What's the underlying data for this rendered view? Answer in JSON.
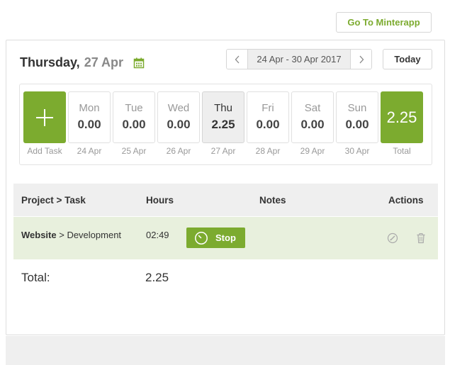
{
  "header": {
    "goto_label": "Go To Minterapp"
  },
  "toolbar": {
    "weekday": "Thursday,",
    "daymonth": "27 Apr",
    "calendar_icon": "calendar-icon",
    "range_label": "24 Apr - 30 Apr 2017",
    "prev_icon": "chevron-left-icon",
    "next_icon": "chevron-right-icon",
    "today_label": "Today"
  },
  "week": {
    "add_label": "Add Task",
    "add_icon": "plus-icon",
    "days": [
      {
        "name": "Mon",
        "value": "0.00",
        "date": "24 Apr",
        "active": false
      },
      {
        "name": "Tue",
        "value": "0.00",
        "date": "25 Apr",
        "active": false
      },
      {
        "name": "Wed",
        "value": "0.00",
        "date": "26 Apr",
        "active": false
      },
      {
        "name": "Thu",
        "value": "2.25",
        "date": "27 Apr",
        "active": true
      },
      {
        "name": "Fri",
        "value": "0.00",
        "date": "28 Apr",
        "active": false
      },
      {
        "name": "Sat",
        "value": "0.00",
        "date": "29 Apr",
        "active": false
      },
      {
        "name": "Sun",
        "value": "0.00",
        "date": "30 Apr",
        "active": false
      }
    ],
    "total_value": "2.25",
    "total_label": "Total"
  },
  "table": {
    "headers": {
      "project_task": "Project > Task",
      "hours": "Hours",
      "notes": "Notes",
      "actions": "Actions"
    },
    "rows": [
      {
        "project": "Website",
        "separator": " > ",
        "task": "Development",
        "hours": "02:49",
        "stop_label": "Stop",
        "stop_icon": "clock-icon",
        "edit_icon": "edit-icon",
        "delete_icon": "trash-icon"
      }
    ]
  },
  "summary": {
    "total_label": "Total:",
    "total_value": "2.25"
  },
  "colors": {
    "accent": "#7cab2f",
    "row_highlight": "#e8f0dd",
    "header_bg": "#efefef"
  }
}
